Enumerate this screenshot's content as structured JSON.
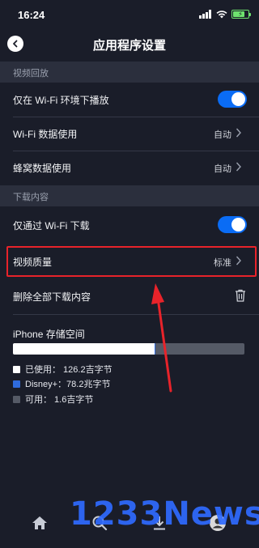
{
  "status_bar": {
    "time": "16:24",
    "battery_percent": 80,
    "colors": {
      "battery": "#6ee26e"
    }
  },
  "header": {
    "title": "应用程序设置",
    "back_icon": "chevron-left-icon"
  },
  "sections": {
    "playback": {
      "title": "视频回放",
      "wifi_only_play": {
        "label": "仅在 Wi-Fi 环境下播放",
        "enabled": true
      },
      "wifi_data": {
        "label": "Wi-Fi 数据使用",
        "value": "自动"
      },
      "cellular_data": {
        "label": "蜂窝数据使用",
        "value": "自动"
      }
    },
    "downloads": {
      "title": "下载内容",
      "wifi_only_download": {
        "label": "仅通过 Wi-Fi 下载",
        "enabled": true
      },
      "video_quality": {
        "label": "视频质量",
        "value": "标准"
      },
      "delete_all": {
        "label": "删除全部下载内容"
      }
    }
  },
  "storage": {
    "title": "iPhone 存储空间",
    "used_fraction": 0.611,
    "disney_fraction": 0.0004,
    "legend": {
      "used": "已使用： 126.2吉字节",
      "disney": "Disney+：78.2兆字节",
      "free": "可用： 1.6吉字节"
    },
    "colors": {
      "used": "#ffffff",
      "disney": "#2f6bdd",
      "free": "#555a66"
    }
  },
  "watermark": "1233News",
  "colors": {
    "background": "#1a1d29",
    "section_header": "#2b2f3d",
    "toggle_on": "#0a6cf5",
    "highlight": "#e8232a"
  }
}
